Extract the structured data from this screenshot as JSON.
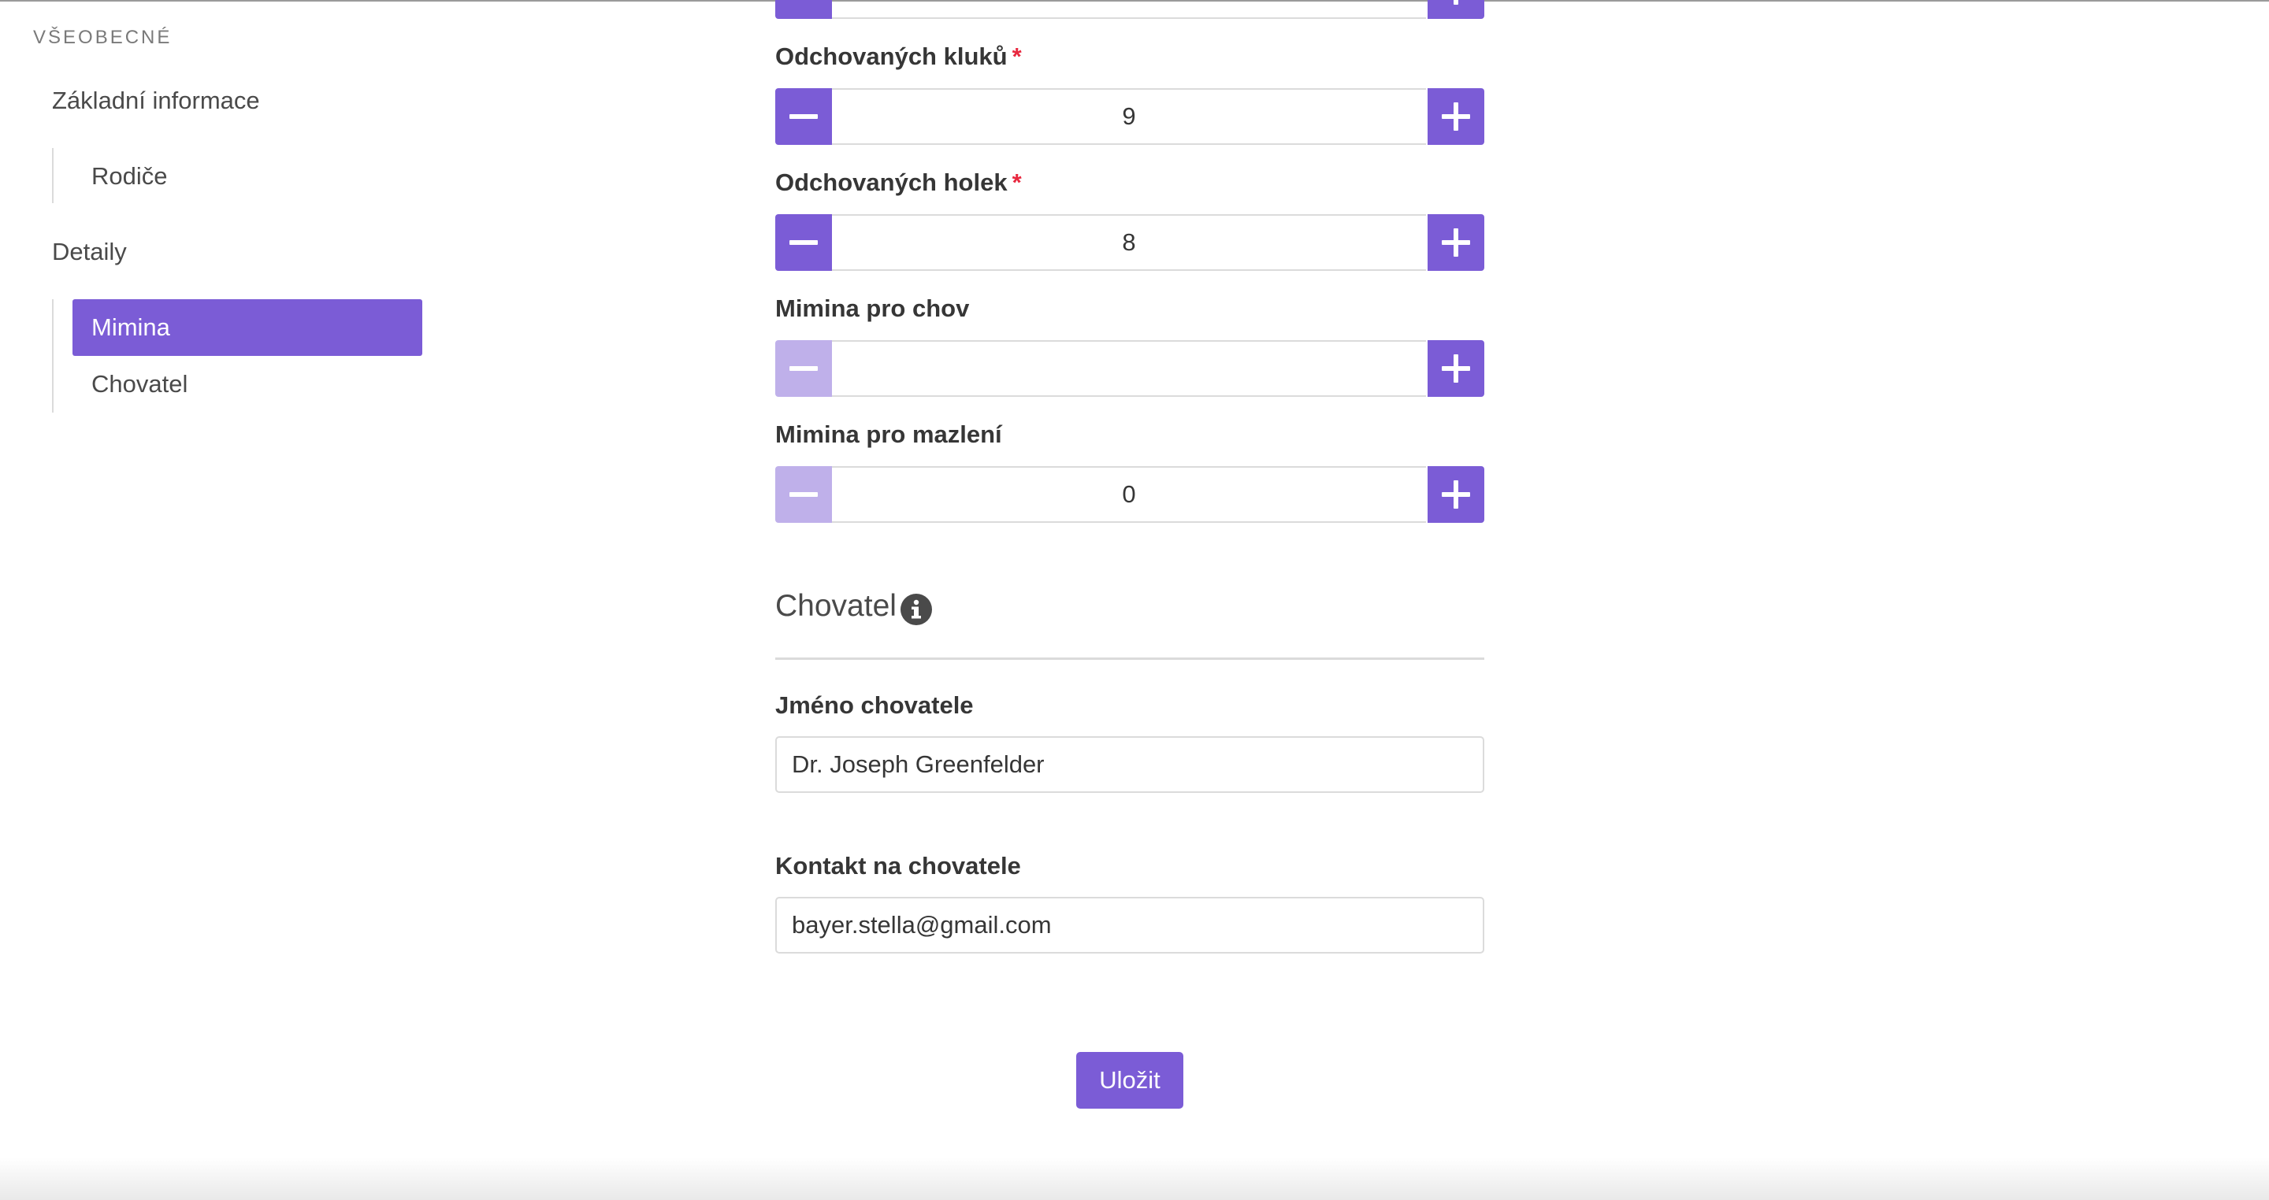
{
  "sidebar": {
    "section_label": "VŠEOBECNÉ",
    "items": [
      {
        "label": "Základní informace"
      },
      {
        "label": "Rodiče"
      },
      {
        "label": "Detaily"
      },
      {
        "label": "Mimina",
        "active": true
      },
      {
        "label": "Chovatel"
      }
    ]
  },
  "form": {
    "fields": [
      {
        "label": "Odchovaných kluků",
        "required": true,
        "value": "9"
      },
      {
        "label": "Odchovaných holek",
        "required": true,
        "value": "8"
      },
      {
        "label": "Mimina pro chov",
        "required": false,
        "value": ""
      },
      {
        "label": "Mimina pro mazlení",
        "required": false,
        "value": "0"
      }
    ],
    "required_mark": "*",
    "section": {
      "title": "Chovatel",
      "icon": "info-icon"
    },
    "breeder_name": {
      "label": "Jméno chovatele",
      "value": "Dr. Joseph Greenfelder"
    },
    "breeder_contact": {
      "label": "Kontakt na chovatele",
      "value": "bayer.stella@gmail.com"
    },
    "save_label": "Uložit"
  },
  "colors": {
    "accent": "#7b5cd6",
    "accent_disabled": "#bfb0ea",
    "required": "#e8283f"
  }
}
